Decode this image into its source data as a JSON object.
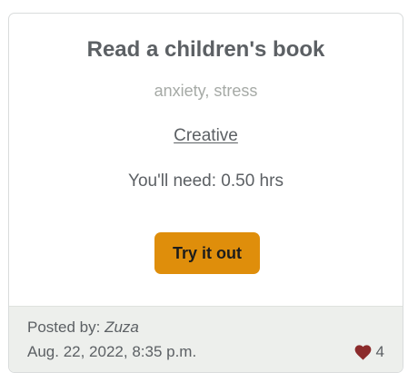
{
  "card": {
    "title": "Read a children's book",
    "tags": "anxiety, stress",
    "category": "Creative",
    "duration_label": "You'll need:",
    "duration_value": "0.50 hrs",
    "cta_label": "Try it out",
    "footer": {
      "posted_by_label": "Posted by:",
      "author": "Zuza",
      "date": "Aug. 22, 2022, 8:35 p.m.",
      "likes_count": "4",
      "likes_icon": "heart-icon"
    }
  },
  "colors": {
    "accent_button": "#df8e0b",
    "heart": "#8b2b2b",
    "text": "#5c6064",
    "tags": "#a6aaa6",
    "footer_bg": "#edefec"
  }
}
